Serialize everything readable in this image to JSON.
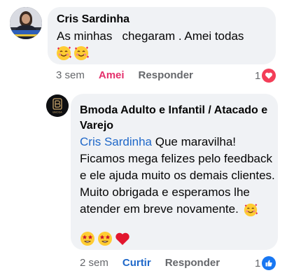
{
  "comment": {
    "author": "Cris Sardinha",
    "text": "As minhas   chegaram . Amei todas",
    "emojis": [
      "smiling-face-with-hearts",
      "smiling-face-with-hearts"
    ],
    "time": "3 sem",
    "reaction_label": "Amei",
    "reply_label": "Responder",
    "reaction_count": "1",
    "reaction_type": "love"
  },
  "reply": {
    "author": "Bmoda Adulto e Infantil / Atacado e Varejo",
    "avatar_text": "BMODA",
    "mention": "Cris Sardinha",
    "text_after_mention": " Que maravilha! Ficamos mega felizes pelo feedback e ele ajuda muito os demais clientes.",
    "text_line2": "Muito obrigada e esperamos lhe atender em breve novamente.",
    "emojis": [
      "star-struck",
      "star-struck",
      "red-heart"
    ],
    "time": "2 sem",
    "like_label": "Curtir",
    "reply_label": "Responder",
    "reaction_count": "1",
    "reaction_type": "like"
  },
  "colors": {
    "bubble": "#f0f2f5",
    "mention": "#1f68c9",
    "love": "#f33e58",
    "like": "#1877f2",
    "meta": "#65676b"
  }
}
